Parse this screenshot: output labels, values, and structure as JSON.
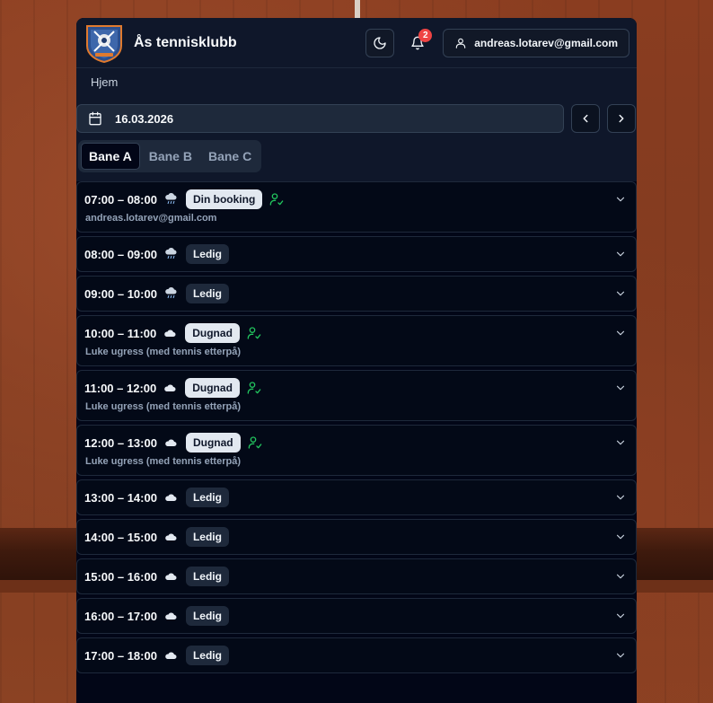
{
  "app": {
    "title": "Ås tennisklubb",
    "notifications_count": "2",
    "user_email": "andreas.lotarev@gmail.com"
  },
  "breadcrumb": "Hjem",
  "date": "16.03.2026",
  "tabs": [
    {
      "label": "Bane A",
      "active": true
    },
    {
      "label": "Bane B",
      "active": false
    },
    {
      "label": "Bane C",
      "active": false
    }
  ],
  "slots": [
    {
      "time": "07:00 – 08:00",
      "weather": "rain-cloud-icon",
      "status": "Din booking",
      "style": "light",
      "check": true,
      "sub": "andreas.lotarev@gmail.com"
    },
    {
      "time": "08:00 – 09:00",
      "weather": "rain-cloud-icon",
      "status": "Ledig",
      "style": "dark",
      "check": false,
      "sub": ""
    },
    {
      "time": "09:00 – 10:00",
      "weather": "rain-cloud-icon",
      "status": "Ledig",
      "style": "dark",
      "check": false,
      "sub": ""
    },
    {
      "time": "10:00 – 11:00",
      "weather": "cloud-icon",
      "status": "Dugnad",
      "style": "light",
      "check": true,
      "sub": "Luke ugress (med tennis etterpå)"
    },
    {
      "time": "11:00 – 12:00",
      "weather": "cloud-icon",
      "status": "Dugnad",
      "style": "light",
      "check": true,
      "sub": "Luke ugress (med tennis etterpå)"
    },
    {
      "time": "12:00 – 13:00",
      "weather": "cloud-icon",
      "status": "Dugnad",
      "style": "light",
      "check": true,
      "sub": "Luke ugress (med tennis etterpå)"
    },
    {
      "time": "13:00 – 14:00",
      "weather": "cloud-icon",
      "status": "Ledig",
      "style": "dark",
      "check": false,
      "sub": ""
    },
    {
      "time": "14:00 – 15:00",
      "weather": "cloud-icon",
      "status": "Ledig",
      "style": "dark",
      "check": false,
      "sub": ""
    },
    {
      "time": "15:00 – 16:00",
      "weather": "cloud-icon",
      "status": "Ledig",
      "style": "dark",
      "check": false,
      "sub": ""
    },
    {
      "time": "16:00 – 17:00",
      "weather": "cloud-icon",
      "status": "Ledig",
      "style": "dark",
      "check": false,
      "sub": ""
    },
    {
      "time": "17:00 – 18:00",
      "weather": "cloud-icon",
      "status": "Ledig",
      "style": "dark",
      "check": false,
      "sub": ""
    }
  ],
  "colors": {
    "background": "#020617",
    "panel": "#0f172a",
    "accent_green": "#22c55e",
    "badge_red": "#ef4444"
  }
}
